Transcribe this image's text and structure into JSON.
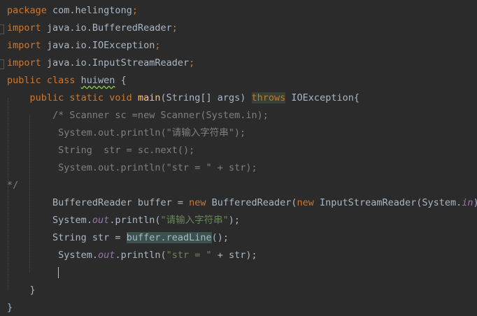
{
  "editor": {
    "lines": [
      [
        [
          "kw",
          "package "
        ],
        [
          "pl",
          "com.helingtong"
        ],
        [
          "kw",
          ";"
        ]
      ],
      [
        [
          "kw",
          "import "
        ],
        [
          "pl",
          "java.io.BufferedReader"
        ],
        [
          "kw",
          ";"
        ]
      ],
      [
        [
          "kw",
          "import "
        ],
        [
          "pl",
          "java.io.IOException"
        ],
        [
          "kw",
          ";"
        ]
      ],
      [
        [
          "kw",
          "import "
        ],
        [
          "pl",
          "java.io.InputStreamReader"
        ],
        [
          "kw",
          ";"
        ]
      ],
      [
        [
          "kw",
          "public class "
        ],
        [
          "sq",
          "huiwen"
        ],
        [
          "pl",
          " {"
        ]
      ],
      [
        [
          "pl",
          "    "
        ],
        [
          "kw",
          "public static void "
        ],
        [
          "fn",
          "main"
        ],
        [
          "pl",
          "(String[] args) "
        ],
        [
          "kwhl",
          "throws"
        ],
        [
          "pl",
          " IOException{"
        ]
      ],
      [
        [
          "cm",
          "        /* Scanner sc =new Scanner(System.in);"
        ]
      ],
      [
        [
          "cm",
          "         System.out.println(\"请输入字符串\");"
        ]
      ],
      [
        [
          "cm",
          "         String  str = sc.next();"
        ]
      ],
      [
        [
          "cm",
          "         System.out.println(\"str = \" + str);"
        ]
      ],
      [
        [
          "cm",
          "*/"
        ]
      ],
      [
        [
          "pl",
          "        BufferedReader buffer = "
        ],
        [
          "kw",
          "new "
        ],
        [
          "pl",
          "BufferedReader("
        ],
        [
          "kw",
          "new "
        ],
        [
          "pl",
          "InputStreamReader(System."
        ],
        [
          "fld",
          "in"
        ],
        [
          "pl",
          "));"
        ]
      ],
      [
        [
          "pl",
          "        System."
        ],
        [
          "fld",
          "out"
        ],
        [
          "pl",
          ".println("
        ],
        [
          "st",
          "\"请输入字符串\""
        ],
        [
          "pl",
          ");"
        ]
      ],
      [
        [
          "pl",
          "        String str = "
        ],
        [
          "hl",
          "buffer.readLine"
        ],
        [
          "pl",
          "();"
        ]
      ],
      [
        [
          "pl",
          "         System."
        ],
        [
          "fld",
          "out"
        ],
        [
          "pl",
          ".println("
        ],
        [
          "st",
          "\"str = \""
        ],
        [
          "pl",
          " + str);"
        ]
      ],
      [
        [
          "pl",
          "         "
        ],
        [
          "caret",
          ""
        ]
      ],
      [
        [
          "pl",
          "    }"
        ]
      ],
      [
        [
          "pl",
          "}"
        ]
      ]
    ]
  }
}
